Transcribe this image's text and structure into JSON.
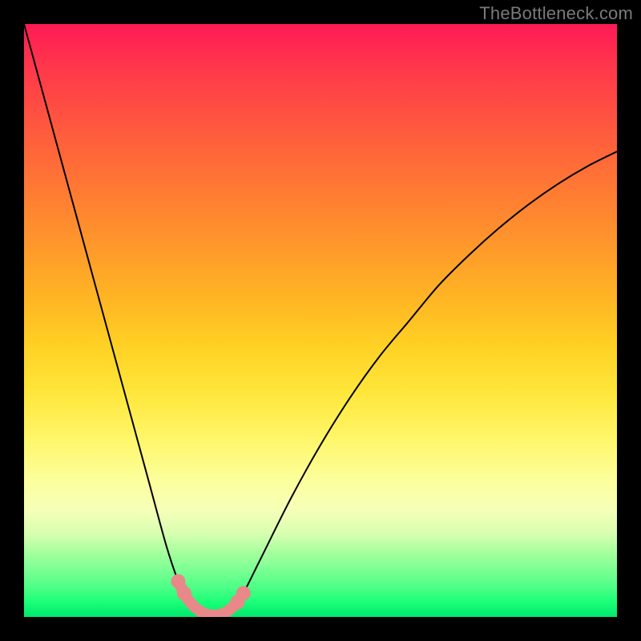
{
  "watermark": "TheBottleneck.com",
  "chart_data": {
    "type": "line",
    "title": "",
    "xlabel": "",
    "ylabel": "",
    "xlim": [
      0,
      100
    ],
    "ylim": [
      0,
      100
    ],
    "x": [
      0,
      3,
      6,
      9,
      12,
      15,
      18,
      21,
      24,
      26,
      27,
      28,
      29,
      30,
      31,
      32,
      33,
      34,
      35,
      36,
      37,
      40,
      45,
      50,
      55,
      60,
      65,
      70,
      75,
      80,
      85,
      90,
      95,
      100
    ],
    "values": [
      100,
      89,
      78,
      67,
      56,
      45,
      34,
      23,
      12,
      6,
      4,
      2.5,
      1.5,
      0.8,
      0.4,
      0.3,
      0.4,
      0.8,
      1.5,
      2.5,
      4,
      10,
      20,
      29,
      37,
      44,
      50,
      56,
      61,
      65.5,
      69.5,
      73,
      76,
      78.5
    ],
    "annotations": {
      "highlighted_x_range": [
        26,
        37
      ],
      "highlighted_dots_x": [
        26,
        27,
        36,
        37
      ],
      "meaning": "Vertex (minimum) of the bottleneck curve highlighted in light red"
    },
    "colors": {
      "curve": "#000000",
      "accent": "#e98888",
      "gradient_top": "#ff1a55",
      "gradient_mid": "#ffe63a",
      "gradient_bottom": "#00e86c",
      "frame": "#000000",
      "watermark": "#7a7a7a"
    }
  }
}
